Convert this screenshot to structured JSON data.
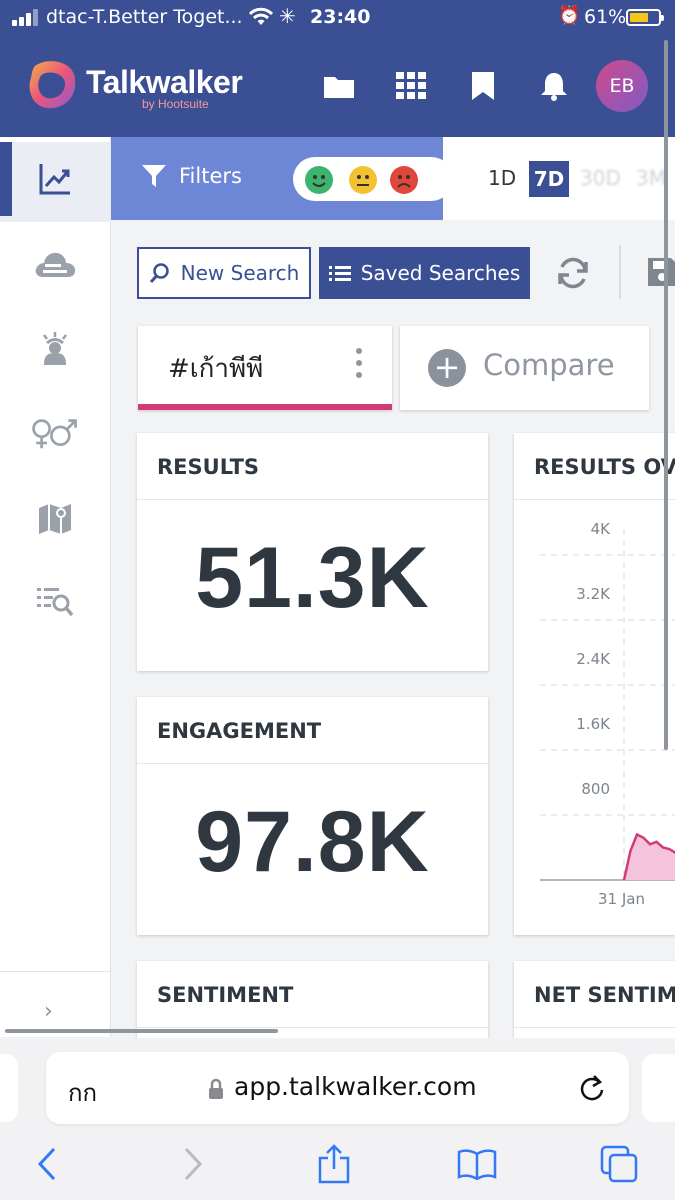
{
  "status_bar": {
    "carrier": "dtac-T.Better Toget...",
    "time": "23:40",
    "battery": "61%",
    "battery_level": 0.61
  },
  "header": {
    "brand": "Talkwalker",
    "brand_sub": "by Hootsuite",
    "user_initials": "EB",
    "icons": [
      "folder-icon",
      "apps-grid-icon",
      "bookmark-icon",
      "bell-icon"
    ]
  },
  "sidebar": {
    "items": [
      "trend-chart-icon",
      "cloud-icon",
      "influencer-icon",
      "gender-icon",
      "map-icon",
      "results-search-icon"
    ]
  },
  "filters": {
    "label": "Filters",
    "sentiments": [
      "positive",
      "neutral",
      "negative"
    ],
    "date_ranges": [
      "1D",
      "7D",
      "30D",
      "3M"
    ],
    "selected_range": "7D"
  },
  "search": {
    "new_search": "New Search",
    "saved_searches": "Saved Searches"
  },
  "query": {
    "tab_label": "#เก้าพีพี",
    "compare_label": "Compare"
  },
  "widgets": {
    "results": {
      "title": "RESULTS",
      "value": "51.3K"
    },
    "engagement": {
      "title": "ENGAGEMENT",
      "value": "97.8K"
    },
    "results_over_time": {
      "title": "RESULTS OV"
    },
    "sentiment": {
      "title": "SENTIMENT"
    },
    "net_sentiment": {
      "title": "NET SENTIM"
    }
  },
  "chart_data": {
    "type": "area",
    "yticks": [
      "4K",
      "3.2K",
      "2.4K",
      "1.6K",
      "800"
    ],
    "ylim": [
      0,
      4800
    ],
    "xticks": [
      "31 Jan"
    ],
    "series": [
      {
        "values": [
          0,
          360,
          560,
          520,
          440,
          470,
          400,
          380,
          330
        ]
      }
    ],
    "colors": {
      "line": "#d23b7a",
      "fill": "#f4c3dc"
    }
  },
  "browser": {
    "aa_label": "กก",
    "url": "app.talkwalker.com"
  },
  "colors": {
    "primary": "#3a4f94",
    "filter_bar": "#6e86d6",
    "accent": "#d23b7a"
  }
}
